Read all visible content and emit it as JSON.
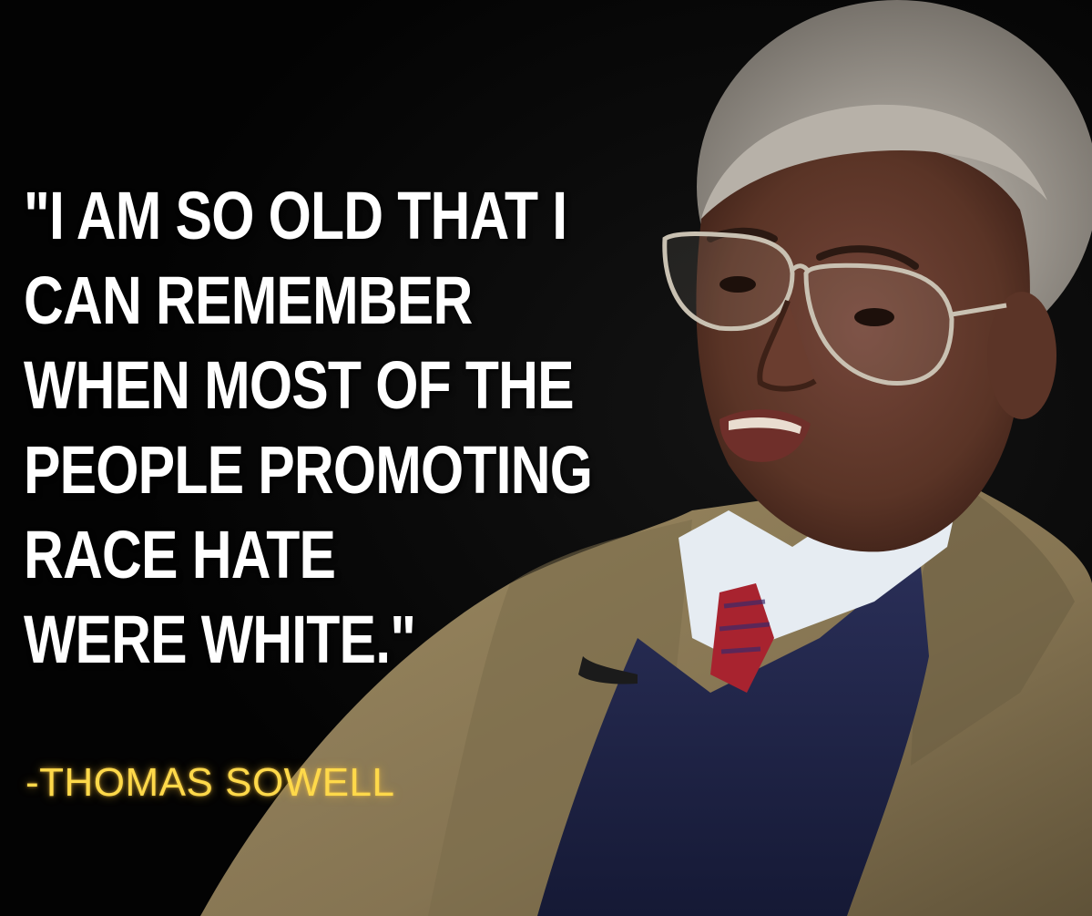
{
  "quote": {
    "lines": [
      "\"I AM SO OLD THAT I",
      "CAN REMEMBER",
      "WHEN MOST OF THE",
      "PEOPLE PROMOTING",
      "RACE HATE",
      "WERE WHITE.\""
    ]
  },
  "attribution": {
    "text": "-THOMAS SOWELL",
    "color": "#ffd94a"
  },
  "colors": {
    "background": "#040404",
    "quote_text": "#ffffff",
    "jacket": "#8a7a55",
    "sweater": "#1f2448",
    "shirt": "#e6ecf2",
    "tie": "#a8232f",
    "hair": "#a9a49c",
    "skin": "#5a3426"
  }
}
